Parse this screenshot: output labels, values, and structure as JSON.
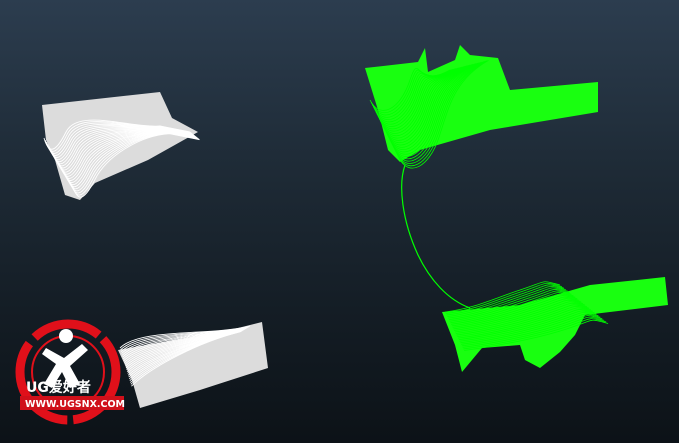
{
  "viewport": {
    "background_top": "#2c3d4f",
    "background_bottom": "#0c1217"
  },
  "model": {
    "green_color": "#00ff00",
    "white_color": "#f2f2f2",
    "shaded_green": "#19ff10",
    "shaded_white": "#dcdcdc"
  },
  "watermark": {
    "brand": "UG爱好者",
    "url": "WWW.UGSNX.COM",
    "ring_color": "#e0101a"
  }
}
